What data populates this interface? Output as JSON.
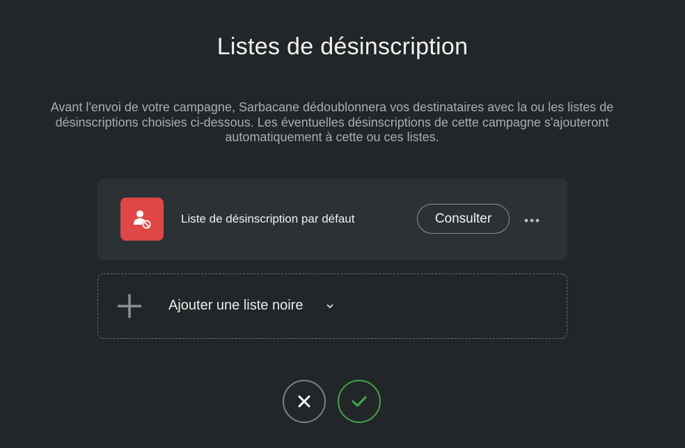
{
  "page": {
    "title": "Listes de désinscription",
    "description": "Avant l'envoi de votre campagne, Sarbacane dédoublonnera vos destinataires avec la ou les listes de désinscriptions choisies ci-dessous. Les éventuelles désinscriptions de cette campagne s'ajouteront automatiquement à cette ou ces listes."
  },
  "lists": [
    {
      "name": "Liste de désinscription par défaut",
      "icon": "user-blocked-icon",
      "icon_color": "#e04646",
      "consult_label": "Consulter",
      "more_icon": "more-dots-icon"
    }
  ],
  "add_list": {
    "label": "Ajouter une liste noire",
    "icon": "plus-icon",
    "chevron_icon": "chevron-down-icon"
  },
  "actions": {
    "cancel_icon": "close-icon",
    "confirm_icon": "check-icon",
    "confirm_color": "#3ea54a"
  }
}
